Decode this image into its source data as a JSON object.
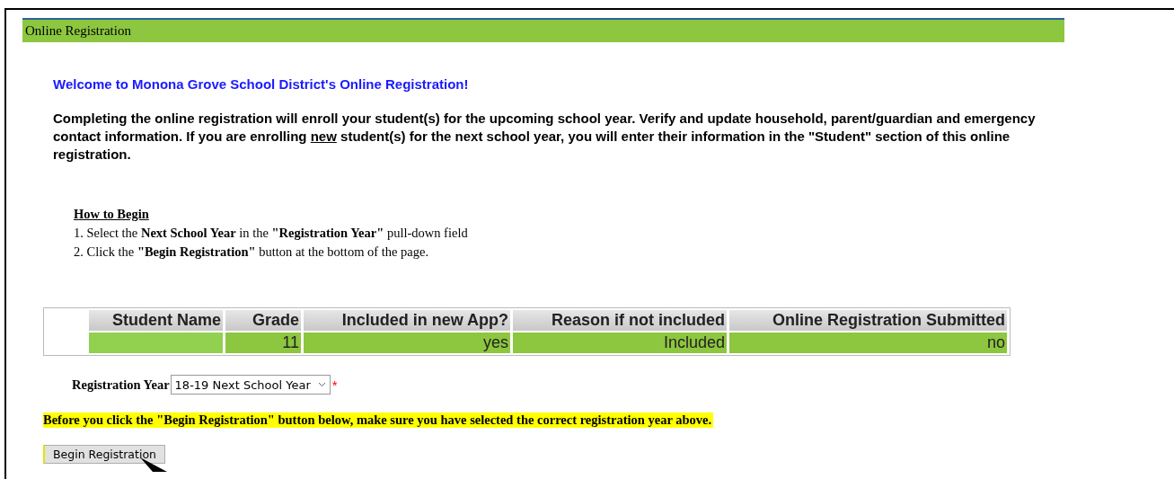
{
  "panel_title": "Online Registration",
  "welcome": "Welcome to Monona Grove School District's Online Registration!",
  "intro": {
    "before": "Completing the online registration will enroll your student(s) for the upcoming school year. Verify and update household, parent/guardian and emergency contact information. If you are enrolling ",
    "underlined": "new",
    "after": " student(s) for the next school year, you will enter their information in the \"Student\" section of this online registration."
  },
  "how_to": {
    "title": "How to Begin",
    "steps": [
      "1. Select the **Next School Year** in the **\"Registration Year\"** pull-down field",
      "2. Click the **\"Begin Registration\"** button at the bottom of the page."
    ]
  },
  "table": {
    "columns": [
      "Student Name",
      "Grade",
      "Included in new App?",
      "Reason if not included",
      "Online Registration Submitted"
    ],
    "rows": [
      {
        "cells": [
          {
            "text": null
          },
          {
            "text": "11"
          },
          {
            "text": "yes"
          },
          {
            "text": "Included"
          },
          {
            "text": "no"
          }
        ]
      }
    ]
  },
  "registration_year": {
    "label": "Registration Year",
    "value": "18-19 Next School Year",
    "required_mark": "*"
  },
  "notice": "Before you click the \"Begin Registration\" button below, make sure you have selected the correct registration year above.",
  "begin_button": "Begin Registration"
}
